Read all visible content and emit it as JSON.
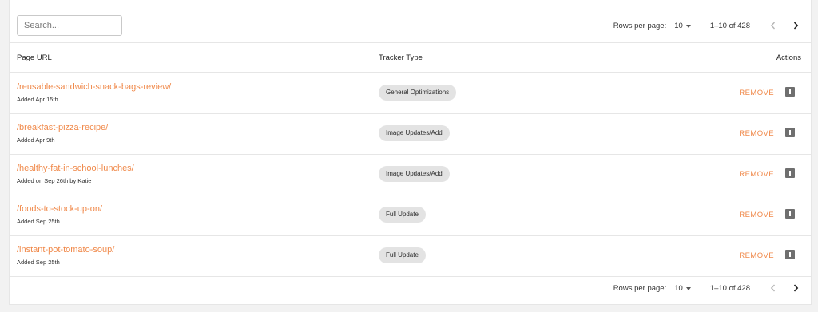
{
  "search": {
    "placeholder": "Search..."
  },
  "pagination": {
    "rows_per_page_label": "Rows per page:",
    "rows_per_page_value": "10",
    "range_text": "1–10 of 428",
    "prev_icon": "chevron-left-icon",
    "next_icon": "chevron-right-icon"
  },
  "columns": {
    "page_url": "Page URL",
    "tracker_type": "Tracker Type",
    "actions": "Actions"
  },
  "rows": [
    {
      "url": "/reusable-sandwich-snack-bags-review/",
      "added": "Added Apr 15th",
      "tracker_type": "General Optimizations",
      "remove_label": "REMOVE"
    },
    {
      "url": "/breakfast-pizza-recipe/",
      "added": "Added Apr 9th",
      "tracker_type": "Image Updates/Add",
      "remove_label": "REMOVE"
    },
    {
      "url": "/healthy-fat-in-school-lunches/",
      "added": "Added on Sep 26th by Katie",
      "tracker_type": "Image Updates/Add",
      "remove_label": "REMOVE"
    },
    {
      "url": "/foods-to-stock-up-on/",
      "added": "Added Sep 25th",
      "tracker_type": "Full Update",
      "remove_label": "REMOVE"
    },
    {
      "url": "/instant-pot-tomato-soup/",
      "added": "Added Sep 25th",
      "tracker_type": "Full Update",
      "remove_label": "REMOVE"
    }
  ],
  "colors": {
    "accent": "#f0894a",
    "chip_bg": "#e3e3e3",
    "stats_icon": "#6f6f6f"
  }
}
